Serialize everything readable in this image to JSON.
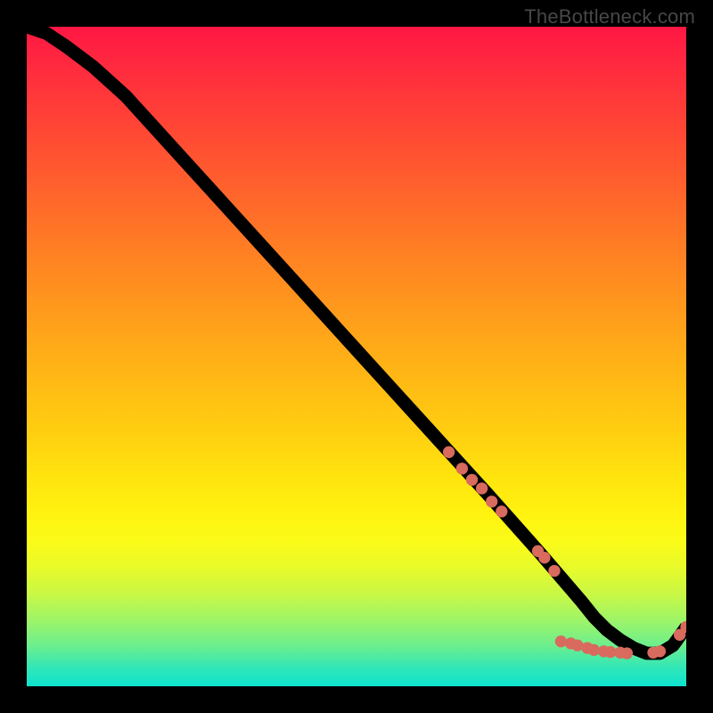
{
  "watermark": "TheBottleneck.com",
  "chart_data": {
    "type": "line",
    "title": "",
    "xlabel": "",
    "ylabel": "",
    "xlim": [
      0,
      100
    ],
    "ylim": [
      0,
      100
    ],
    "grid": false,
    "series": [
      {
        "name": "bottleneck-curve",
        "x": [
          0,
          3,
          6,
          10,
          15,
          20,
          25,
          30,
          35,
          40,
          45,
          50,
          55,
          60,
          65,
          70,
          74,
          78,
          81,
          84,
          86,
          88,
          90,
          92,
          94,
          96,
          98,
          100
        ],
        "values": [
          100,
          99,
          97,
          94,
          89.5,
          84,
          78.5,
          73,
          67.5,
          62,
          56.5,
          51,
          45.5,
          40,
          34.5,
          29,
          24.5,
          20,
          16.5,
          13,
          10.5,
          8.5,
          7,
          5.8,
          5,
          5,
          6.2,
          9
        ]
      }
    ],
    "markers": [
      {
        "x": 64,
        "y": 35.5
      },
      {
        "x": 66,
        "y": 33
      },
      {
        "x": 67.5,
        "y": 31.3
      },
      {
        "x": 69,
        "y": 30
      },
      {
        "x": 70.5,
        "y": 28
      },
      {
        "x": 72,
        "y": 26.5
      },
      {
        "x": 77.5,
        "y": 20.5
      },
      {
        "x": 78.5,
        "y": 19.5
      },
      {
        "x": 80,
        "y": 17.5
      },
      {
        "x": 81,
        "y": 6.8
      },
      {
        "x": 82.5,
        "y": 6.5
      },
      {
        "x": 83.5,
        "y": 6.2
      },
      {
        "x": 85,
        "y": 5.8
      },
      {
        "x": 86,
        "y": 5.5
      },
      {
        "x": 87.5,
        "y": 5.3
      },
      {
        "x": 88.5,
        "y": 5.2
      },
      {
        "x": 90,
        "y": 5.1
      },
      {
        "x": 91,
        "y": 5.0
      },
      {
        "x": 95,
        "y": 5.1
      },
      {
        "x": 96,
        "y": 5.3
      },
      {
        "x": 99,
        "y": 7.8
      },
      {
        "x": 100,
        "y": 9.0
      }
    ],
    "colors": {
      "curve": "#000000",
      "marker": "#d96a5e",
      "gradient_top": "#ff1744",
      "gradient_mid": "#ffe30e",
      "gradient_bottom": "#0de3cf"
    }
  }
}
